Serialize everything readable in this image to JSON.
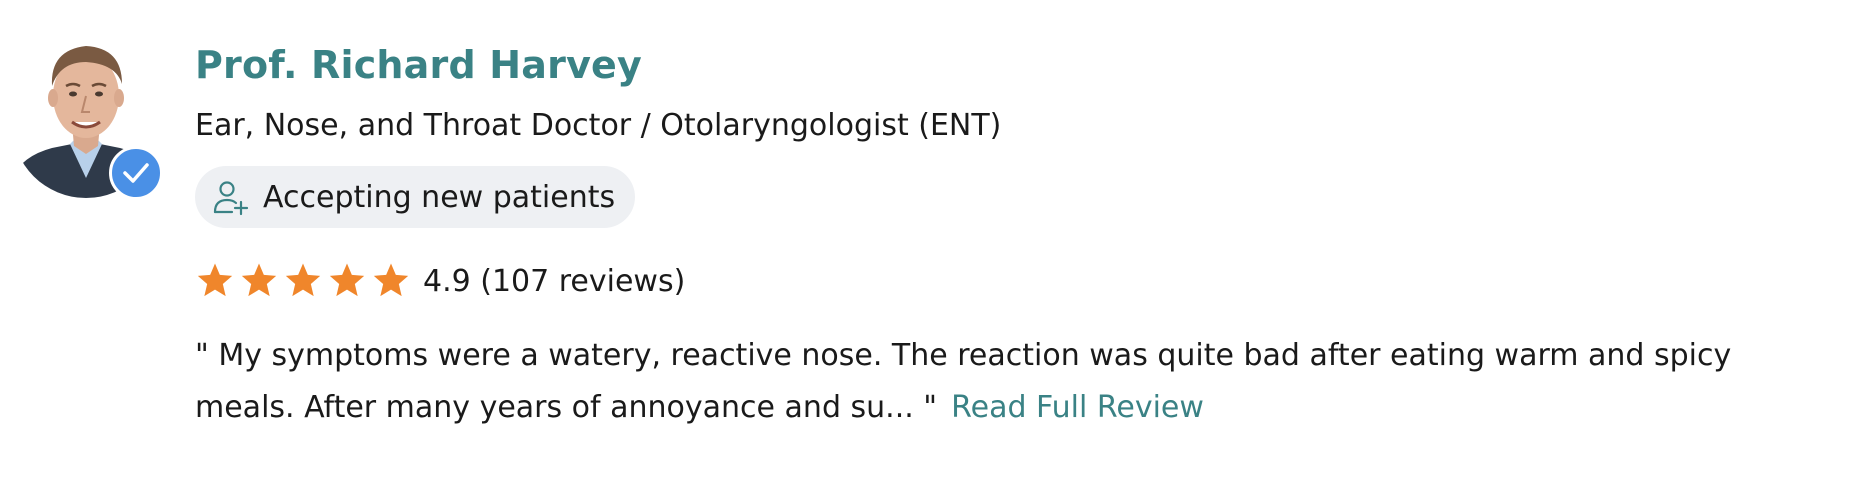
{
  "doctor": {
    "name": "Prof. Richard Harvey",
    "specialty": "Ear, Nose, and Throat Doctor / Otolaryngologist (ENT)",
    "verified": true,
    "avatar_icon": "doctor-photo"
  },
  "availability": {
    "label": "Accepting new patients",
    "icon": "add-user-icon"
  },
  "rating": {
    "stars": 5,
    "stars_filled": 5,
    "text": "4.9 (107 reviews)",
    "star_color": "#f0862b"
  },
  "review": {
    "excerpt": "\" My symptoms were a watery, reactive nose. The reaction was quite bad after eating warm and spicy meals. After many years of annoyance and su... \"",
    "link_label": "Read Full Review"
  },
  "colors": {
    "accent": "#3a8285",
    "badge": "#4a90e6",
    "pill_bg": "#eef0f3"
  }
}
